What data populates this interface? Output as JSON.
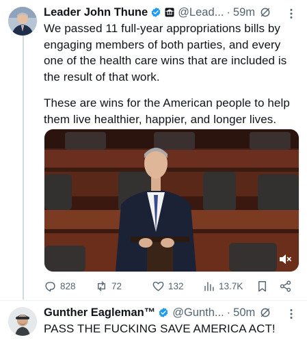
{
  "tweet1": {
    "author_name": "Leader John Thune",
    "handle": "@Lead...",
    "separator": "·",
    "time": "59m",
    "paragraph1": "We passed 11 full-year appropriations bills by engaging members of both parties, and every one of the health care wins that are included is the result of that work.",
    "paragraph2": "These are wins for the American people to help them live healthier, happier, and longer lives.",
    "stats": {
      "replies": "828",
      "reposts": "72",
      "likes": "132",
      "views": "13.7K"
    }
  },
  "tweet2": {
    "author_name": "Gunther Eagleman™",
    "handle": "@Gunth...",
    "separator": "·",
    "time": "50m",
    "text": "PASS THE FUCKING SAVE AMERICA ACT!"
  },
  "icons": {
    "verified_color": "#1d9bf0",
    "accent_color": "#1d9bf0",
    "muted_color": "#536471"
  }
}
